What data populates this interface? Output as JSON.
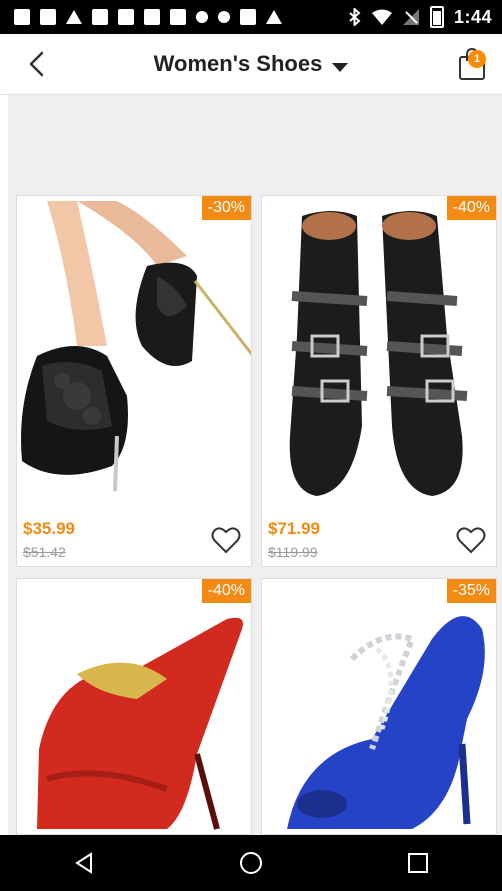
{
  "status_bar": {
    "time": "1:44"
  },
  "header": {
    "title": "Women's Shoes",
    "cart_count": "1"
  },
  "products": [
    {
      "discount": "-30%",
      "price": "$35.99",
      "old_price": "$51.42",
      "image": "black-lace-peep-toe-heel"
    },
    {
      "discount": "-40%",
      "price": "$71.99",
      "old_price": "$119.99",
      "image": "black-studded-buckle-boots"
    },
    {
      "discount": "-40%",
      "price": "",
      "old_price": "",
      "image": "red-platform-heel"
    },
    {
      "discount": "-35%",
      "price": "",
      "old_price": "",
      "image": "blue-satin-jeweled-heel"
    }
  ],
  "colors": {
    "accent": "#f28a14",
    "badge": "#ff8a00"
  }
}
